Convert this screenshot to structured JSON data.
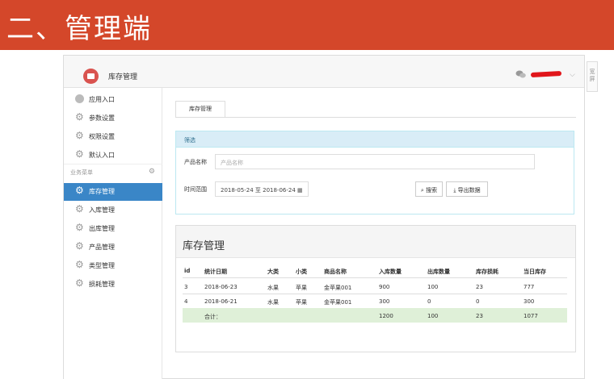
{
  "banner": {
    "title": "二、管理端"
  },
  "app": {
    "title": "库存管理"
  },
  "sidebar": {
    "items": [
      {
        "label": "应用入口",
        "icon": "chat-icon"
      },
      {
        "label": "参数设置",
        "icon": "gear-icon"
      },
      {
        "label": "权限设置",
        "icon": "gear-icon"
      },
      {
        "label": "默认入口",
        "icon": "gear-icon"
      }
    ],
    "section": "业务菜单",
    "business_items": [
      {
        "label": "库存管理",
        "active": true
      },
      {
        "label": "入库管理"
      },
      {
        "label": "出库管理"
      },
      {
        "label": "产品管理"
      },
      {
        "label": "类型管理"
      },
      {
        "label": "损耗管理"
      }
    ]
  },
  "tab": {
    "label": "库存管理"
  },
  "filter": {
    "title": "筛选",
    "product_label": "产品名称",
    "product_placeholder": "产品名称",
    "date_label": "时间范围",
    "date_value": "2018-05-24 至 2018-06-24",
    "search_label": "搜索",
    "export_label": "导出数据"
  },
  "table": {
    "title": "库存管理",
    "columns": [
      "id",
      "统计日期",
      "大类",
      "小类",
      "商品名称",
      "入库数量",
      "出库数量",
      "库存损耗",
      "当日库存"
    ],
    "rows": [
      [
        "3",
        "2018-06-23",
        "水果",
        "苹果",
        "金苹果001",
        "900",
        "100",
        "23",
        "777"
      ],
      [
        "4",
        "2018-06-21",
        "水果",
        "苹果",
        "金苹果001",
        "300",
        "0",
        "0",
        "300"
      ]
    ],
    "total": {
      "label": "合计：",
      "in": "1200",
      "out": "100",
      "loss": "23",
      "stock": "1077"
    }
  },
  "right_strip": {
    "text": "宽屏"
  },
  "colors": {
    "banner": "#d4472a",
    "active": "#3a86c7",
    "filter_head": "#d9edf7",
    "total_row": "#dff0d8"
  }
}
